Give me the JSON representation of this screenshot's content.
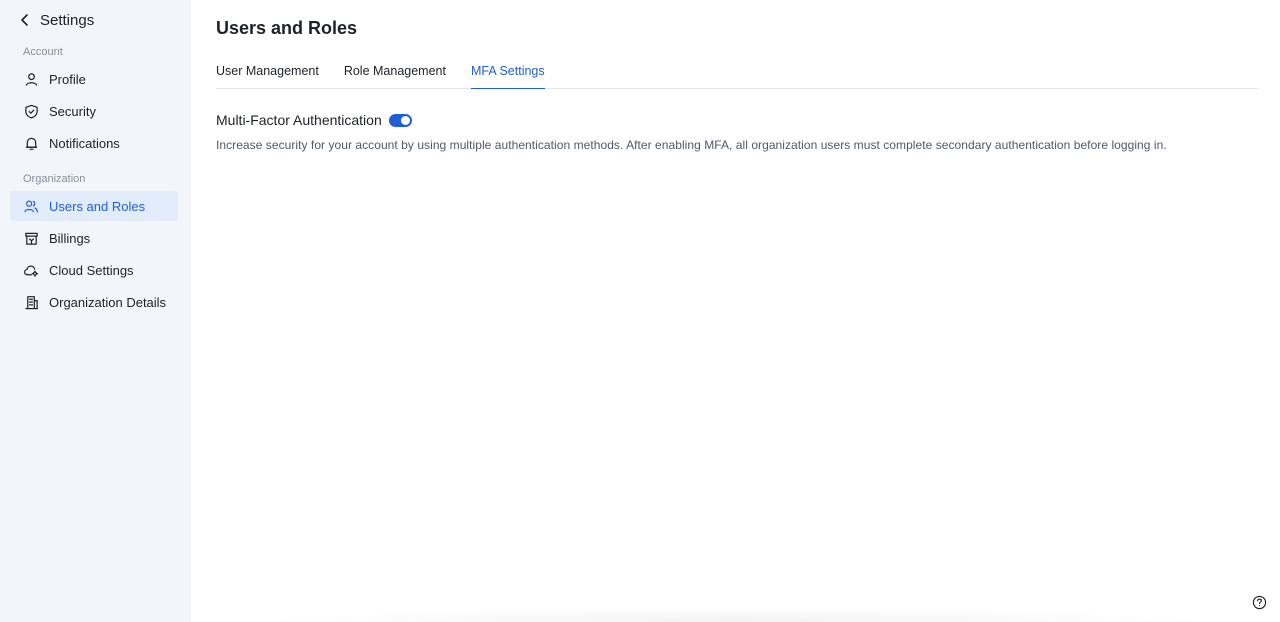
{
  "sidebar": {
    "title": "Settings",
    "groups": [
      {
        "label": "Account",
        "items": [
          {
            "label": "Profile",
            "icon": "user-icon"
          },
          {
            "label": "Security",
            "icon": "shield-icon"
          },
          {
            "label": "Notifications",
            "icon": "bell-icon"
          }
        ]
      },
      {
        "label": "Organization",
        "items": [
          {
            "label": "Users and Roles",
            "icon": "users-icon",
            "active": true
          },
          {
            "label": "Billings",
            "icon": "billing-icon"
          },
          {
            "label": "Cloud Settings",
            "icon": "cloud-gear-icon"
          },
          {
            "label": "Organization Details",
            "icon": "building-icon"
          }
        ]
      }
    ]
  },
  "main": {
    "title": "Users and Roles",
    "tabs": [
      {
        "label": "User Management"
      },
      {
        "label": "Role Management"
      },
      {
        "label": "MFA Settings",
        "active": true
      }
    ],
    "mfa": {
      "title": "Multi-Factor Authentication",
      "enabled": true,
      "description": "Increase security for your account by using multiple authentication methods. After enabling MFA, all organization users must complete secondary authentication before logging in."
    }
  },
  "colors": {
    "accent": "#1f5fd6",
    "sidebar_bg": "#f2f5fa",
    "active_bg": "#e1ebfa"
  }
}
